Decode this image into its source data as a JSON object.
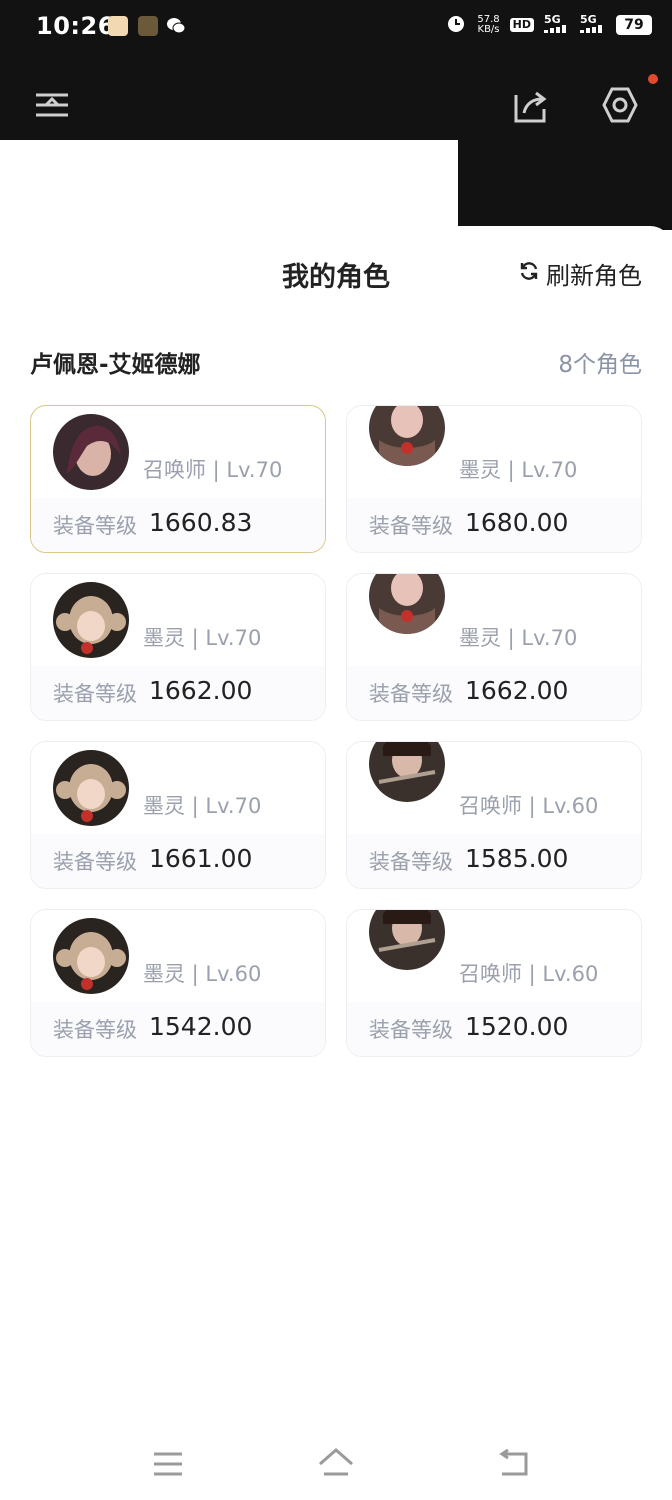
{
  "status_bar": {
    "time": "10:26",
    "net_speed_value": "57.8",
    "net_speed_unit": "KB/s",
    "hd": "HD",
    "sim1": "5G",
    "sim2": "5G",
    "battery": "79"
  },
  "header": {
    "title": "我的角色",
    "refresh_label": "刷新角色"
  },
  "server": {
    "name": "卢佩恩-艾姬德娜",
    "count": "8个角色"
  },
  "characters": [
    {
      "class_level": "召唤师 | Lv.70",
      "gear_label": "装备等级",
      "gear_score": "1660.83",
      "selected": true
    },
    {
      "class_level": "墨灵 | Lv.70",
      "gear_label": "装备等级",
      "gear_score": "1680.00",
      "selected": false
    },
    {
      "class_level": "墨灵 | Lv.70",
      "gear_label": "装备等级",
      "gear_score": "1662.00",
      "selected": false
    },
    {
      "class_level": "墨灵 | Lv.70",
      "gear_label": "装备等级",
      "gear_score": "1662.00",
      "selected": false
    },
    {
      "class_level": "墨灵 | Lv.70",
      "gear_label": "装备等级",
      "gear_score": "1661.00",
      "selected": false
    },
    {
      "class_level": "召唤师 | Lv.60",
      "gear_label": "装备等级",
      "gear_score": "1585.00",
      "selected": false
    },
    {
      "class_level": "墨灵 | Lv.60",
      "gear_label": "装备等级",
      "gear_score": "1542.00",
      "selected": false
    },
    {
      "class_level": "召唤师 | Lv.60",
      "gear_label": "装备等级",
      "gear_score": "1520.00",
      "selected": false
    }
  ],
  "colors": {
    "dark_bar": "#121212",
    "selected_border": "#d8c788",
    "muted_text": "#9aa0ad",
    "notification_dot": "#e04a2c"
  }
}
